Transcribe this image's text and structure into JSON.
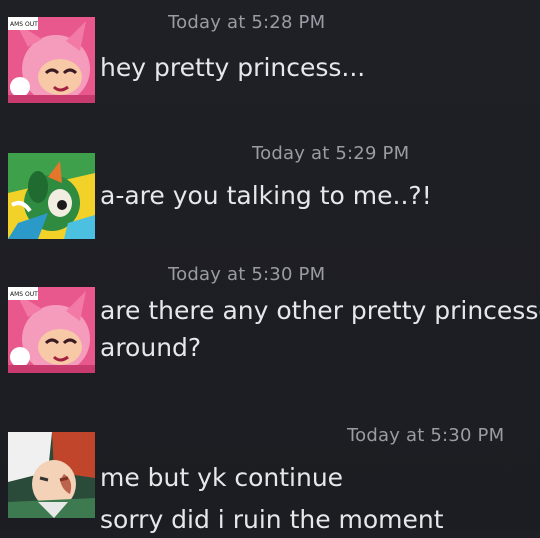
{
  "messages": [
    {
      "user": "pink-hedgehog",
      "timestamp": "Today at 5:28 PM",
      "lines": [
        "hey pretty princess..."
      ]
    },
    {
      "user": "green-character",
      "timestamp": "Today at 5:29 PM",
      "lines": [
        "a-are you talking to me..?!"
      ]
    },
    {
      "user": "pink-hedgehog",
      "timestamp": "Today at 5:30 PM",
      "lines": [
        "are there any other pretty princesses",
        "around?"
      ]
    },
    {
      "user": "red-white-hair-boy",
      "timestamp": "Today at 5:30 PM",
      "lines": [
        "me but yk continue",
        "sorry did i ruin the moment"
      ]
    }
  ],
  "avatar_badges": {
    "pink_avatar_text": "AMS OUT"
  },
  "colors": {
    "background": "#1e1f24",
    "text": "#e6e7ea",
    "timestamp": "#9a9ca3"
  }
}
